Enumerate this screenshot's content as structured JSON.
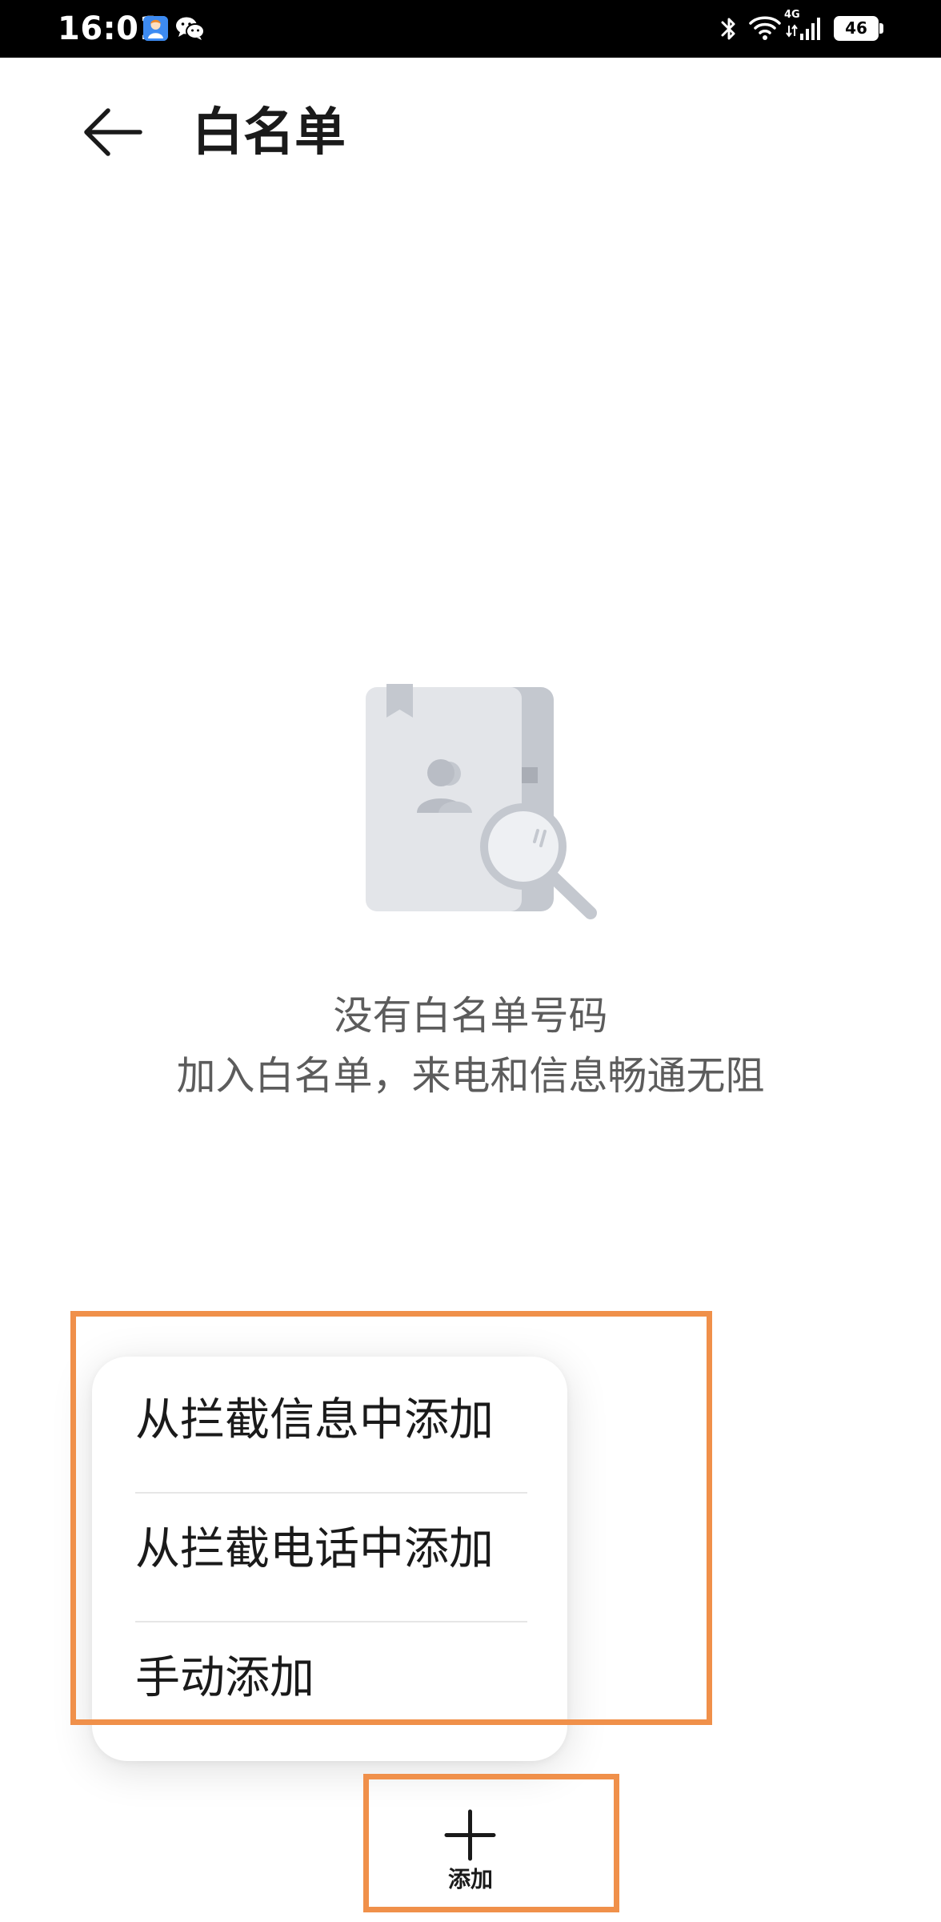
{
  "status_bar": {
    "time": "16:01",
    "network_label": "4G",
    "battery_level": "46",
    "icons": [
      "app-notification-icon",
      "wechat-icon",
      "bluetooth-icon",
      "wifi-icon",
      "cellular-signal-icon",
      "battery-icon"
    ]
  },
  "header": {
    "title": "白名单",
    "back_icon": "arrow-left-icon"
  },
  "empty_state": {
    "illustration": "contact-book-search-icon",
    "title": "没有白名单号码",
    "subtitle": "加入白名单，来电和信息畅通无阻"
  },
  "add_menu": {
    "items": [
      {
        "label": "从拦截信息中添加"
      },
      {
        "label": "从拦截电话中添加"
      },
      {
        "label": "手动添加"
      }
    ]
  },
  "bottom_bar": {
    "add_icon": "plus-icon",
    "add_label": "添加"
  },
  "colors": {
    "highlight": "#f0904a",
    "text_primary": "#1a1a1a",
    "text_secondary": "#5c5c5c",
    "illustration_gray": "#c4c8cf"
  }
}
